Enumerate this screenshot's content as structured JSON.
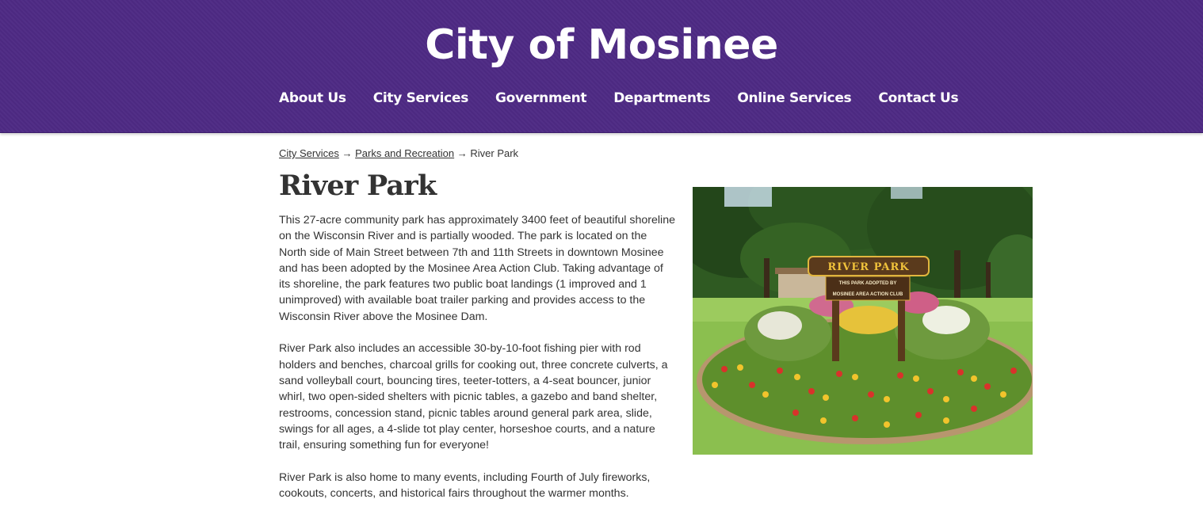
{
  "header": {
    "site_title": "City of Mosinee",
    "nav": [
      {
        "label": "About Us"
      },
      {
        "label": "City Services"
      },
      {
        "label": "Government"
      },
      {
        "label": "Departments"
      },
      {
        "label": "Online Services"
      },
      {
        "label": "Contact Us"
      }
    ]
  },
  "breadcrumb": {
    "items": [
      {
        "label": "City Services"
      },
      {
        "label": "Parks and Recreation"
      }
    ],
    "separator": "→",
    "current": "River Park"
  },
  "page": {
    "title": "River Park",
    "paragraphs": [
      "This 27-acre community park has approximately 3400 feet of beautiful shoreline on the Wisconsin River and is partially wooded. The park is located on the North side of Main Street between 7th and 11th Streets in downtown Mosinee and has been adopted by the Mosinee Area Action Club. Taking advantage of its shoreline, the park features two public boat landings (1 improved and 1 unimproved) with available boat trailer parking and provides access to the Wisconsin River above the Mosinee Dam.",
      "River Park also includes an accessible 30-by-10-foot fishing pier with rod holders and benches, charcoal grills for cooking out, three concrete culverts, a sand volleyball court, bouncing tires, teeter-totters, a 4-seat bouncer, junior whirl, two open-sided shelters with picnic tables, a gazebo and band shelter, restrooms, concession stand, picnic tables around general park area, slide, swings for all ages, a 4-slide tot play center, horseshoe courts, and a nature trail, ensuring something fun for everyone!",
      "River Park is also home to many events, including Fourth of July fireworks, cookouts, concerts, and historical fairs throughout the warmer months."
    ]
  },
  "photo": {
    "sign_title": "RIVER PARK",
    "sign_line1": "THIS PARK ADOPTED BY",
    "sign_line2": "MOSINEE AREA ACTION CLUB"
  },
  "colors": {
    "header_purple": "#4e2a84",
    "text": "#333333",
    "sign_gold": "#f0c23b",
    "sign_brown": "#5a3a1c"
  }
}
